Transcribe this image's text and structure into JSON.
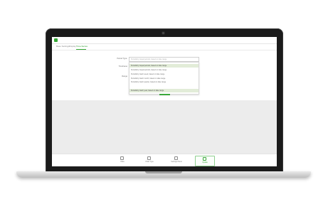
{
  "app": {
    "topbar": {
      "crumbs": [
        "",
        "",
        ""
      ],
      "right": [
        "",
        ""
      ]
    },
    "tabs": [
      "Base Settings",
      "Display",
      "Time-Series"
    ],
    "form": {
      "labels": [
        "Period Type:",
        "Timeframe",
        "Range",
        ""
      ],
      "select_value": "Periodicity: Equal periods, based on date range",
      "options": [
        "Periodicity: Equal periods, based on date range",
        "Periodicity: Equal periods, based on date range",
        "Periodicity: Each week, based on date range",
        "Periodicity: Each month, based on date range",
        "Periodicity: Each quarter, based on date range",
        "Periodicity: Each year, based on date range"
      ],
      "highlighted_option_indices": [
        0,
        5
      ]
    },
    "bottom_nav": [
      "Data",
      "Chart Type",
      "Settings Panel",
      "Update"
    ],
    "colors": {
      "accent": "#36a936",
      "highlight": "#e2ecd8",
      "grey_area": "#ececec"
    }
  }
}
